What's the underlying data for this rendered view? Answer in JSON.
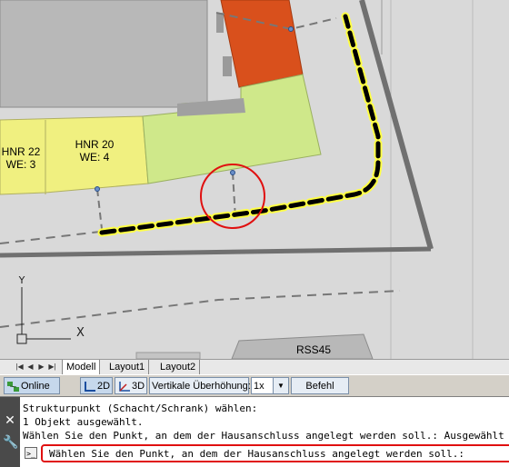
{
  "map": {
    "labels": [
      {
        "id": "hnr22",
        "line1": "HNR 22",
        "line2": "WE: 3"
      },
      {
        "id": "hnr20",
        "line1": "HNR 20",
        "line2": "WE: 4"
      },
      {
        "id": "rss45",
        "line1": "RSS45"
      }
    ],
    "colors": {
      "background": "#d9d9d9",
      "building_gray": "#b8b8b8",
      "building_orange": "#d9501c",
      "parcel_yellow": "#f0f080",
      "parcel_green": "#cfe88a",
      "highlight_circle": "#e01010",
      "selected_line_halo": "#ffff44"
    }
  },
  "tabs": {
    "items": [
      {
        "label": "Modell",
        "active": true
      },
      {
        "label": "Layout1",
        "active": false
      },
      {
        "label": "Layout2",
        "active": false
      }
    ]
  },
  "statusbar": {
    "online_label": "Online",
    "view2d_label": "2D",
    "view3d_label": "3D",
    "exaggeration_label": "Vertikale Überhöhung:",
    "exaggeration_value": "1x",
    "command_button_label": "Befehl"
  },
  "command": {
    "history": [
      "Strukturpunkt (Schacht/Schrank) wählen:",
      "1 Objekt ausgewählt.",
      "Wählen Sie den Punkt, an dem der Hausanschluss angelegt werden soll.: Ausgewählt"
    ],
    "prompt": "Wählen Sie den Punkt, an dem der Hausanschluss angelegt werden soll.:"
  }
}
